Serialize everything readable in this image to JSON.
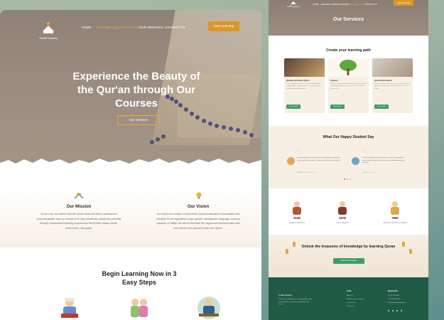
{
  "left": {
    "logo_text": "Thriftie Academy",
    "nav": [
      "HOME",
      "BECOME A QURAN TEACHER",
      "OUR SERVICES",
      "CONTACT US"
    ],
    "start_button": "Start Learning",
    "hero_title": "Experience the Beauty of the Qur'an through Our Courses",
    "hero_button": "Our Services",
    "mission_title": "Our Mission",
    "mission_text": "At our core, we believe that the Quran holds the key to spiritual and personal growth, and our mission is to help individuals unlock this potential through personalized learning experiences that fit their unique needs, preferences, and goals.",
    "vision_title": "Our Vision",
    "vision_text": "Our vision is to create a world where Quranic education is accessible and inclusive for all regardless of age, gender, background, language, memory capacity, or ability. We aim to eliminate the stigma and misconception that one needs to be special to learn the Quran.",
    "steps_title": "Begin Learning Now in 3 Easy Steps"
  },
  "right": {
    "logo_text": "Thriftie Academy",
    "nav": [
      "HOME",
      "BECOME A QURAN TEACHER",
      "OUR SERVICES",
      "CONTACT US"
    ],
    "start_button": "Start Learning",
    "hero_title": "Our Services",
    "path_title": "Create your learning path",
    "cards": [
      {
        "title": "Reading, Recitation Quran",
        "text": "This course will take you to read and pronounce Arabic properly. Build a reading course in our course to learn proper letters and Tajweed rules.",
        "button": "View details"
      },
      {
        "title": "Tajweed",
        "text": "The Quran Tajweed course will help you recite the Quran exactly the way it was revealed, with correct rules and pronunciation.",
        "button": "View details"
      },
      {
        "title": "Quran Memorization",
        "text": "Read and memorize the Quran at your own pace with our guidance. Get the tools to retain memorized verses for a lifetime.",
        "button": "View details"
      }
    ],
    "testimonials_title": "What Our Happy Student Say",
    "testimonials": [
      {
        "text": "I received teachers that keep your child engaged as they learn Quran and Islamic studies. Customer service is also top notch!",
        "name": "SAMER HATTAM, 10 Lesson"
      },
      {
        "text": "I found this highly recommend their service. I've managed to move classes around a time to fit my very flexible around your schedule.",
        "name": "SANGHEDI, 12 Lesson"
      }
    ],
    "stats": [
      {
        "value": "2135",
        "label": "Registered Members"
      },
      {
        "value": "1578",
        "label": "Active Students"
      },
      {
        "value": "7660",
        "label": "Classroom Sessions Completed"
      }
    ],
    "unlock_title": "Unlock the treasures of knowledge by learning Quran",
    "unlock_button": "Book a Trial Session",
    "footer": {
      "about": "Thriftie Quran Academy is an independent online teaching quran organization dedicated to the Quran.",
      "col1_head": "Links",
      "col1_items": [
        "About Us",
        "Become a Quran Teacher",
        "Our Services",
        "Contact Us"
      ],
      "col2_head": "Reach Now",
      "col2_items": [
        "+1 416 123 4567",
        "+1 416 987 6543",
        "info@thriftieacademy.com"
      ]
    }
  },
  "colors": {
    "accent": "#d9982a",
    "green": "#3f9b6a",
    "footer": "#1f5a45",
    "cream": "#f7efe4"
  }
}
